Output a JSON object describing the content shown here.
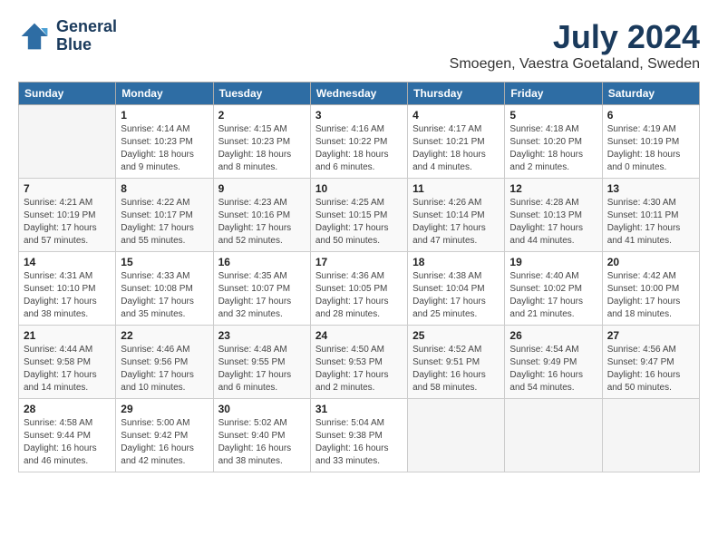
{
  "header": {
    "logo": {
      "line1": "General",
      "line2": "Blue"
    },
    "title": "July 2024",
    "subtitle": "Smoegen, Vaestra Goetaland, Sweden"
  },
  "calendar": {
    "days_of_week": [
      "Sunday",
      "Monday",
      "Tuesday",
      "Wednesday",
      "Thursday",
      "Friday",
      "Saturday"
    ],
    "weeks": [
      [
        {
          "day": "",
          "info": ""
        },
        {
          "day": "1",
          "info": "Sunrise: 4:14 AM\nSunset: 10:23 PM\nDaylight: 18 hours\nand 9 minutes."
        },
        {
          "day": "2",
          "info": "Sunrise: 4:15 AM\nSunset: 10:23 PM\nDaylight: 18 hours\nand 8 minutes."
        },
        {
          "day": "3",
          "info": "Sunrise: 4:16 AM\nSunset: 10:22 PM\nDaylight: 18 hours\nand 6 minutes."
        },
        {
          "day": "4",
          "info": "Sunrise: 4:17 AM\nSunset: 10:21 PM\nDaylight: 18 hours\nand 4 minutes."
        },
        {
          "day": "5",
          "info": "Sunrise: 4:18 AM\nSunset: 10:20 PM\nDaylight: 18 hours\nand 2 minutes."
        },
        {
          "day": "6",
          "info": "Sunrise: 4:19 AM\nSunset: 10:19 PM\nDaylight: 18 hours\nand 0 minutes."
        }
      ],
      [
        {
          "day": "7",
          "info": "Sunrise: 4:21 AM\nSunset: 10:19 PM\nDaylight: 17 hours\nand 57 minutes."
        },
        {
          "day": "8",
          "info": "Sunrise: 4:22 AM\nSunset: 10:17 PM\nDaylight: 17 hours\nand 55 minutes."
        },
        {
          "day": "9",
          "info": "Sunrise: 4:23 AM\nSunset: 10:16 PM\nDaylight: 17 hours\nand 52 minutes."
        },
        {
          "day": "10",
          "info": "Sunrise: 4:25 AM\nSunset: 10:15 PM\nDaylight: 17 hours\nand 50 minutes."
        },
        {
          "day": "11",
          "info": "Sunrise: 4:26 AM\nSunset: 10:14 PM\nDaylight: 17 hours\nand 47 minutes."
        },
        {
          "day": "12",
          "info": "Sunrise: 4:28 AM\nSunset: 10:13 PM\nDaylight: 17 hours\nand 44 minutes."
        },
        {
          "day": "13",
          "info": "Sunrise: 4:30 AM\nSunset: 10:11 PM\nDaylight: 17 hours\nand 41 minutes."
        }
      ],
      [
        {
          "day": "14",
          "info": "Sunrise: 4:31 AM\nSunset: 10:10 PM\nDaylight: 17 hours\nand 38 minutes."
        },
        {
          "day": "15",
          "info": "Sunrise: 4:33 AM\nSunset: 10:08 PM\nDaylight: 17 hours\nand 35 minutes."
        },
        {
          "day": "16",
          "info": "Sunrise: 4:35 AM\nSunset: 10:07 PM\nDaylight: 17 hours\nand 32 minutes."
        },
        {
          "day": "17",
          "info": "Sunrise: 4:36 AM\nSunset: 10:05 PM\nDaylight: 17 hours\nand 28 minutes."
        },
        {
          "day": "18",
          "info": "Sunrise: 4:38 AM\nSunset: 10:04 PM\nDaylight: 17 hours\nand 25 minutes."
        },
        {
          "day": "19",
          "info": "Sunrise: 4:40 AM\nSunset: 10:02 PM\nDaylight: 17 hours\nand 21 minutes."
        },
        {
          "day": "20",
          "info": "Sunrise: 4:42 AM\nSunset: 10:00 PM\nDaylight: 17 hours\nand 18 minutes."
        }
      ],
      [
        {
          "day": "21",
          "info": "Sunrise: 4:44 AM\nSunset: 9:58 PM\nDaylight: 17 hours\nand 14 minutes."
        },
        {
          "day": "22",
          "info": "Sunrise: 4:46 AM\nSunset: 9:56 PM\nDaylight: 17 hours\nand 10 minutes."
        },
        {
          "day": "23",
          "info": "Sunrise: 4:48 AM\nSunset: 9:55 PM\nDaylight: 17 hours\nand 6 minutes."
        },
        {
          "day": "24",
          "info": "Sunrise: 4:50 AM\nSunset: 9:53 PM\nDaylight: 17 hours\nand 2 minutes."
        },
        {
          "day": "25",
          "info": "Sunrise: 4:52 AM\nSunset: 9:51 PM\nDaylight: 16 hours\nand 58 minutes."
        },
        {
          "day": "26",
          "info": "Sunrise: 4:54 AM\nSunset: 9:49 PM\nDaylight: 16 hours\nand 54 minutes."
        },
        {
          "day": "27",
          "info": "Sunrise: 4:56 AM\nSunset: 9:47 PM\nDaylight: 16 hours\nand 50 minutes."
        }
      ],
      [
        {
          "day": "28",
          "info": "Sunrise: 4:58 AM\nSunset: 9:44 PM\nDaylight: 16 hours\nand 46 minutes."
        },
        {
          "day": "29",
          "info": "Sunrise: 5:00 AM\nSunset: 9:42 PM\nDaylight: 16 hours\nand 42 minutes."
        },
        {
          "day": "30",
          "info": "Sunrise: 5:02 AM\nSunset: 9:40 PM\nDaylight: 16 hours\nand 38 minutes."
        },
        {
          "day": "31",
          "info": "Sunrise: 5:04 AM\nSunset: 9:38 PM\nDaylight: 16 hours\nand 33 minutes."
        },
        {
          "day": "",
          "info": ""
        },
        {
          "day": "",
          "info": ""
        },
        {
          "day": "",
          "info": ""
        }
      ]
    ]
  }
}
